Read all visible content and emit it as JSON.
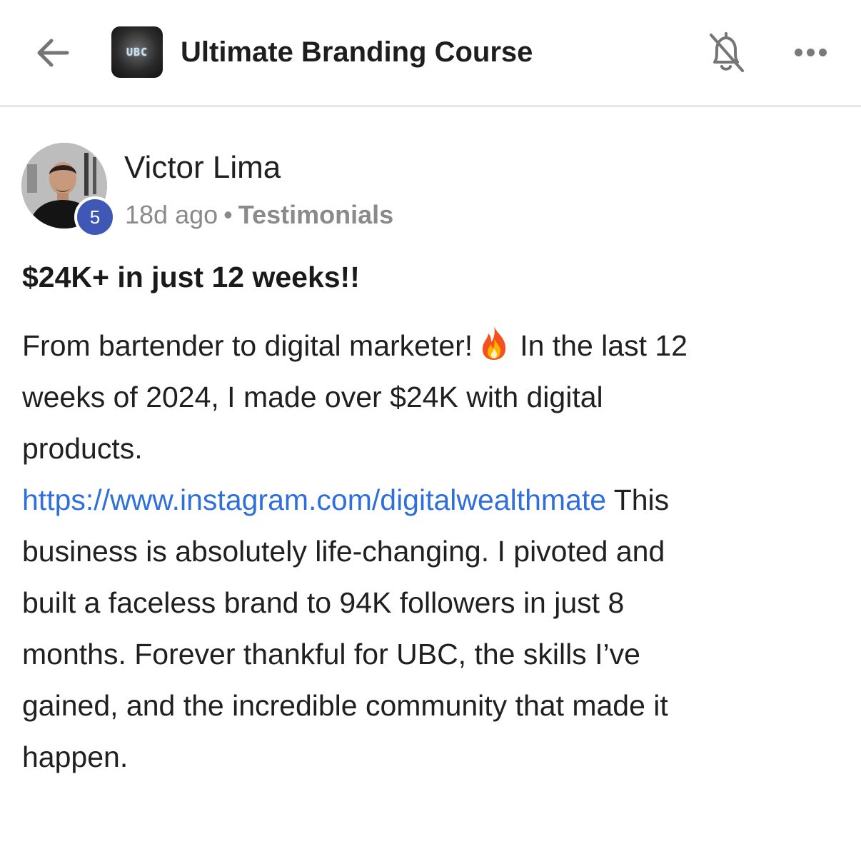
{
  "header": {
    "back_icon": "arrow-left-icon",
    "group_logo_text": "UBC",
    "group_title": "Ultimate Branding Course",
    "bell_icon": "bell-off-icon",
    "more_icon": "more-horizontal-icon"
  },
  "post": {
    "author": {
      "name": "Victor Lima",
      "level": "5",
      "level_color": "#3f57b5"
    },
    "meta": {
      "time": "18d ago",
      "separator": "•",
      "category": "Testimonials"
    },
    "title": "$24K+ in just 12 weeks!!",
    "body": {
      "line1_before": "From bartender to digital marketer!",
      "emoji_icon": "fire-icon",
      "line1_after": "In the last 12",
      "line2": "weeks of 2024, I made over $24K with digital",
      "line3": "products.",
      "link": "https://www.instagram.com/digitalwealthmate",
      "line4_after": " This",
      "line5": "business is absolutely life-changing. I pivoted and",
      "line6": "built a faceless brand to 94K followers in just 8",
      "line7": "months. Forever thankful for UBC, the skills I’ve",
      "line8": "gained, and the incredible community that made it",
      "line9": "happen."
    }
  },
  "colors": {
    "link": "#2f6fdb",
    "divider": "#e6e6e6",
    "meta_text": "#8a8a8a"
  }
}
